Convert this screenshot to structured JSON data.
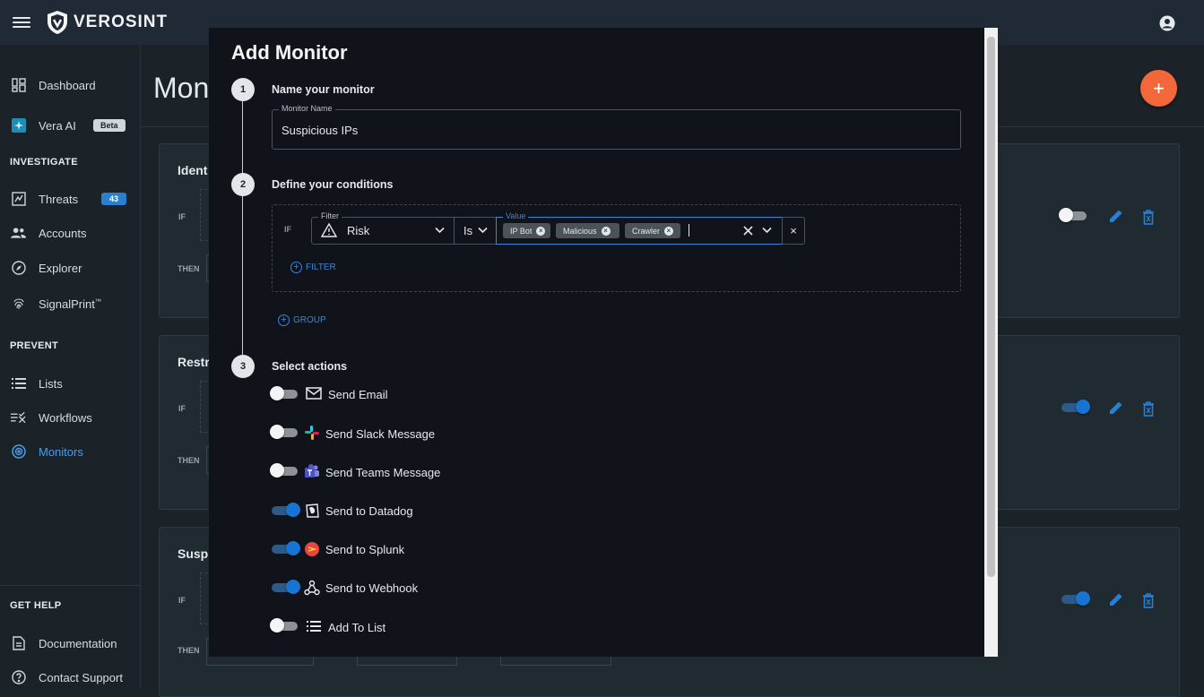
{
  "app": {
    "name": "VEROSINT"
  },
  "sidebar": {
    "items": [
      {
        "label": "Dashboard"
      },
      {
        "label": "Vera AI",
        "badge": "Beta"
      },
      {
        "label": "Threats",
        "badge": "43"
      },
      {
        "label": "Accounts"
      },
      {
        "label": "Explorer"
      },
      {
        "label": "SignalPrint",
        "sup": "™"
      },
      {
        "label": "Lists"
      },
      {
        "label": "Workflows"
      },
      {
        "label": "Monitors"
      },
      {
        "label": "Documentation"
      },
      {
        "label": "Contact Support"
      }
    ],
    "sections": {
      "investigate": "INVESTIGATE",
      "prevent": "PREVENT",
      "help": "GET HELP"
    }
  },
  "page": {
    "title": "Moni"
  },
  "cards": [
    {
      "title": "Ident",
      "if": "IF",
      "then": "THEN",
      "enabled": false
    },
    {
      "title": "Restr",
      "if": "IF",
      "then": "THEN",
      "enabled": true
    },
    {
      "title": "Suspi",
      "if": "IF",
      "then": "THEN",
      "enabled": true
    }
  ],
  "modal": {
    "title": "Add Monitor",
    "steps": [
      {
        "num": "1",
        "title": "Name your monitor"
      },
      {
        "num": "2",
        "title": "Define your conditions"
      },
      {
        "num": "3",
        "title": "Select actions"
      }
    ],
    "name_field": {
      "label": "Monitor Name",
      "value": "Suspicious IPs"
    },
    "condition": {
      "if": "IF",
      "filter_label": "Filter",
      "filter_value": "Risk",
      "operator": "Is",
      "value_label": "Value",
      "chips": [
        "IP Bot",
        "Malicious",
        "Crawler"
      ]
    },
    "add_filter": "FILTER",
    "add_group": "GROUP",
    "actions": [
      {
        "label": "Send Email",
        "enabled": false,
        "icon": "mail-icon"
      },
      {
        "label": "Send Slack Message",
        "enabled": false,
        "icon": "slack-icon"
      },
      {
        "label": "Send Teams Message",
        "enabled": false,
        "icon": "teams-icon"
      },
      {
        "label": "Send to Datadog",
        "enabled": true,
        "icon": "datadog-icon"
      },
      {
        "label": "Send to Splunk",
        "enabled": true,
        "icon": "splunk-icon"
      },
      {
        "label": "Send to Webhook",
        "enabled": true,
        "icon": "webhook-icon"
      },
      {
        "label": "Add To List",
        "enabled": false,
        "icon": "list-icon"
      }
    ]
  },
  "colors": {
    "accent": "#3b86d6",
    "fab": "#f2683a",
    "toggle_on": "#1874d2"
  }
}
